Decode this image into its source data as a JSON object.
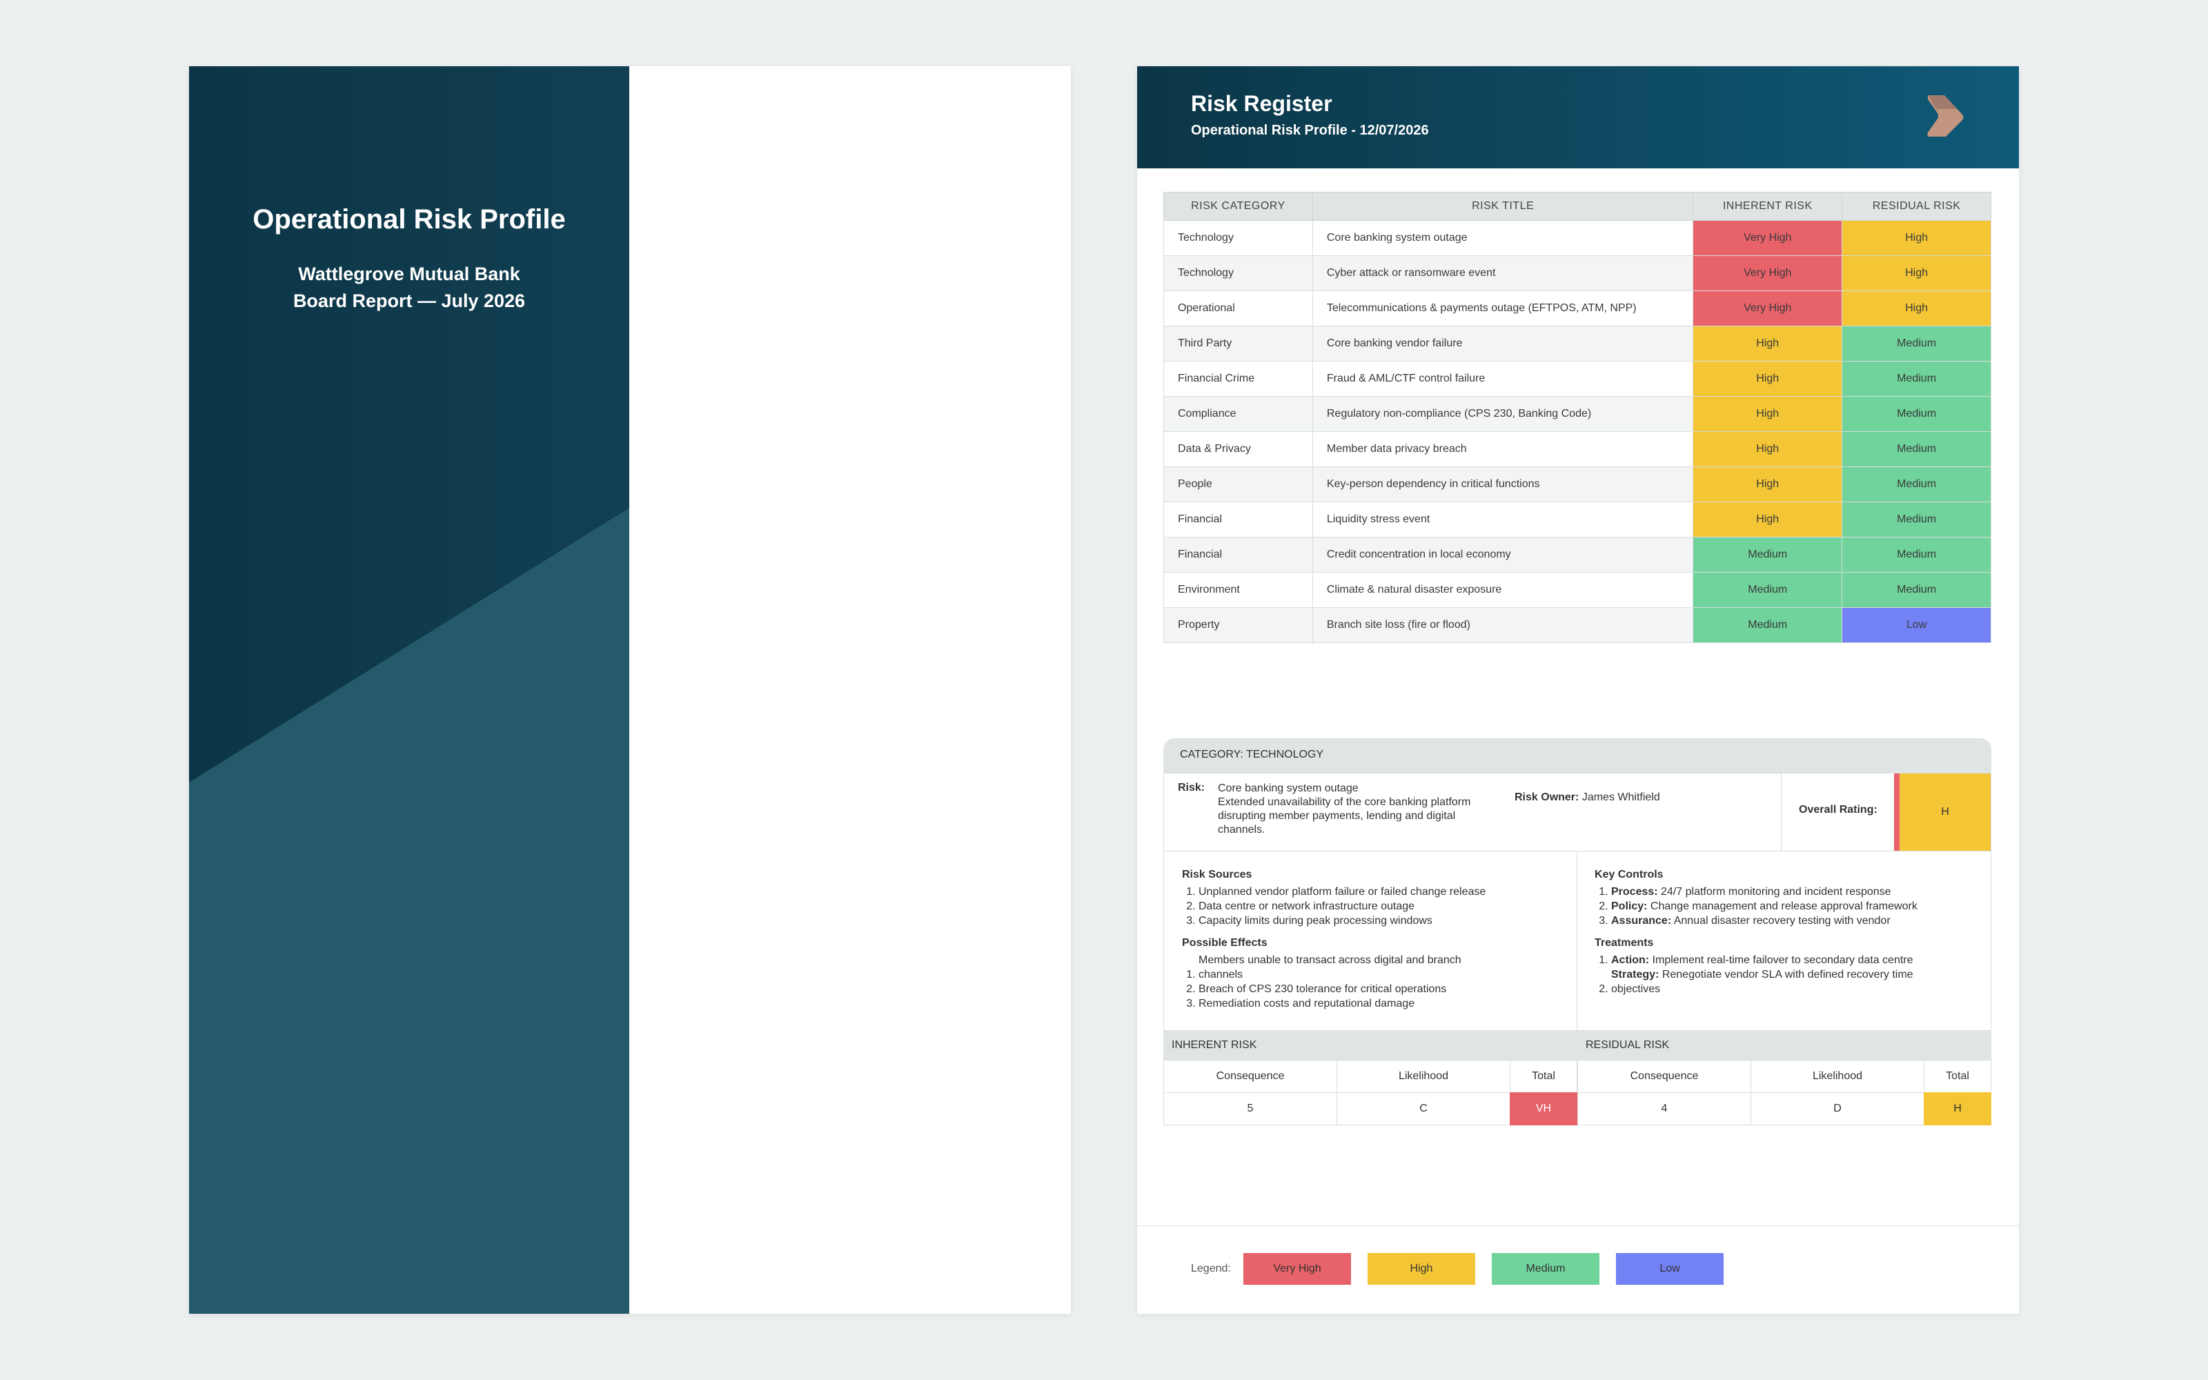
{
  "cover": {
    "title": "Operational Risk Profile",
    "subtitle_line1": "Wattlegrove Mutual Bank",
    "subtitle_line2": "Board Report — July 2026"
  },
  "register": {
    "title": "Risk Register",
    "subtitle": "Operational Risk Profile - 12/07/2026",
    "columns": [
      "RISK CATEGORY",
      "RISK TITLE",
      "INHERENT RISK",
      "RESIDUAL RISK"
    ],
    "rows": [
      {
        "category": "Technology",
        "title": "Core banking system outage",
        "inherent": "Very High",
        "residual": "High"
      },
      {
        "category": "Technology",
        "title": "Cyber attack or ransomware event",
        "inherent": "Very High",
        "residual": "High"
      },
      {
        "category": "Operational",
        "title": "Telecommunications & payments outage (EFTPOS, ATM, NPP)",
        "inherent": "Very High",
        "residual": "High"
      },
      {
        "category": "Third Party",
        "title": "Core banking vendor failure",
        "inherent": "High",
        "residual": "Medium"
      },
      {
        "category": "Financial Crime",
        "title": "Fraud & AML/CTF control failure",
        "inherent": "High",
        "residual": "Medium"
      },
      {
        "category": "Compliance",
        "title": "Regulatory non-compliance (CPS 230, Banking Code)",
        "inherent": "High",
        "residual": "Medium"
      },
      {
        "category": "Data & Privacy",
        "title": "Member data privacy breach",
        "inherent": "High",
        "residual": "Medium"
      },
      {
        "category": "People",
        "title": "Key-person dependency in critical functions",
        "inherent": "High",
        "residual": "Medium"
      },
      {
        "category": "Financial",
        "title": "Liquidity stress event",
        "inherent": "High",
        "residual": "Medium"
      },
      {
        "category": "Financial",
        "title": "Credit concentration in local economy",
        "inherent": "Medium",
        "residual": "Medium"
      },
      {
        "category": "Environment",
        "title": "Climate & natural disaster exposure",
        "inherent": "Medium",
        "residual": "Medium"
      },
      {
        "category": "Property",
        "title": "Branch site loss (fire or flood)",
        "inherent": "Medium",
        "residual": "Low"
      }
    ]
  },
  "detail": {
    "category_label": "CATEGORY: TECHNOLOGY",
    "risk_label": "Risk:",
    "risk_title": "Core banking system outage",
    "risk_description": "Extended unavailability of the core banking platform disrupting member payments, lending and digital channels.",
    "owner_label": "Risk Owner:",
    "owner_name": "James Whitfield",
    "overall_label": "Overall Rating:",
    "overall_value": "H",
    "sources_heading": "Risk Sources",
    "sources": [
      "Unplanned vendor platform failure or failed change release",
      "Data centre or network infrastructure outage",
      "Capacity limits during peak processing windows"
    ],
    "effects_heading": "Possible Effects",
    "effects_first": "Members unable to transact across digital and branch",
    "effects": [
      "channels",
      "Breach of CPS 230 tolerance for critical operations",
      "Remediation costs and reputational damage"
    ],
    "controls_heading": "Key Controls",
    "controls": [
      {
        "label": "Process:",
        "text": "24/7 platform monitoring and incident response"
      },
      {
        "label": "Policy:",
        "text": "Change management and release approval framework"
      },
      {
        "label": "Assurance:",
        "text": "Annual disaster recovery testing with vendor"
      }
    ],
    "treatments_heading": "Treatments",
    "treatment_1_label": "Action:",
    "treatment_1_text": "Implement real-time failover to secondary data centre",
    "treatment_2_label": "Strategy:",
    "treatment_2_text": "Renegotiate vendor SLA with defined recovery time",
    "treatment_2_cont": "objectives",
    "inherent_heading": "INHERENT RISK",
    "residual_heading": "RESIDUAL RISK",
    "col_consequence": "Consequence",
    "col_likelihood": "Likelihood",
    "col_total": "Total",
    "inherent_consequence": "5",
    "inherent_likelihood": "C",
    "inherent_total": "VH",
    "residual_consequence": "4",
    "residual_likelihood": "D",
    "residual_total": "H"
  },
  "legend": {
    "label": "Legend:",
    "items": [
      "Very High",
      "High",
      "Medium",
      "Low"
    ]
  },
  "colors": {
    "very_high": "#e8626a",
    "high": "#f4c534",
    "medium": "#6fd39b",
    "low": "#7282f5",
    "header_dark": "#0c3647",
    "header_mid": "#0f5a78",
    "cover_light": "#255a6a"
  },
  "icons": {
    "logo": "play-chevron-logo-icon"
  }
}
